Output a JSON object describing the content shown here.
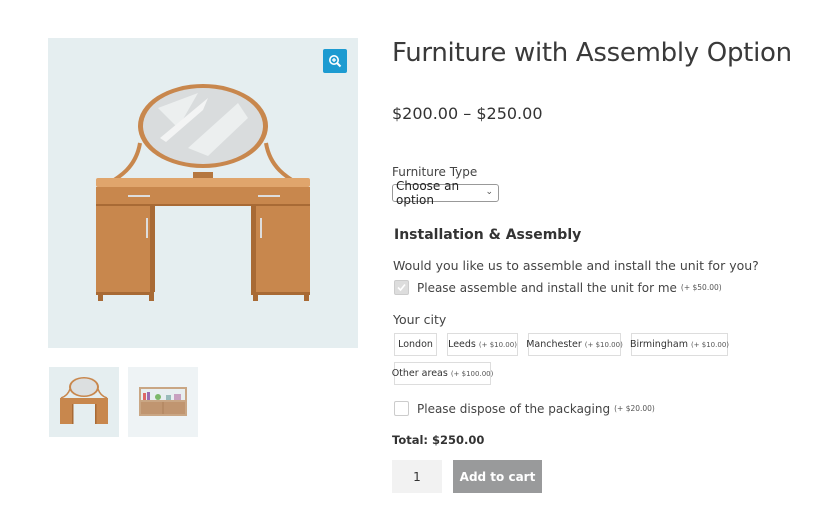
{
  "product": {
    "title": "Furniture with Assembly Option",
    "price_range": "$200.00 – $250.00"
  },
  "gallery": {
    "main_image": "dressing-table-with-mirror",
    "zoom_icon": "zoom-in-icon",
    "zoom_color": "#1d9bd1",
    "thumbnails": [
      {
        "name": "dressing-table-thumbnail"
      },
      {
        "name": "sideboard-thumbnail"
      }
    ]
  },
  "variation": {
    "label": "Furniture Type",
    "select_value": "Choose an option"
  },
  "addons": {
    "heading": "Installation & Assembly",
    "question": "Would you like us to assemble and install the unit for you?",
    "assemble_option": {
      "label": "Please assemble and install the unit for me",
      "price": "(+ $50.00)",
      "checked": true
    },
    "city_label": "Your city",
    "cities": [
      {
        "name": "London",
        "price": ""
      },
      {
        "name": "Leeds",
        "price": "(+ $10.00)"
      },
      {
        "name": "Manchester",
        "price": "(+ $10.00)"
      },
      {
        "name": "Birmingham",
        "price": "(+ $10.00)"
      },
      {
        "name": "Other areas",
        "price": "(+ $100.00)"
      }
    ],
    "dispose_option": {
      "label": "Please dispose of the packaging",
      "price": "(+ $20.00)",
      "checked": false
    }
  },
  "cart": {
    "total": "Total: $250.00",
    "quantity": "1",
    "add_to_cart_label": "Add to cart",
    "button_color": "#999a9b"
  }
}
